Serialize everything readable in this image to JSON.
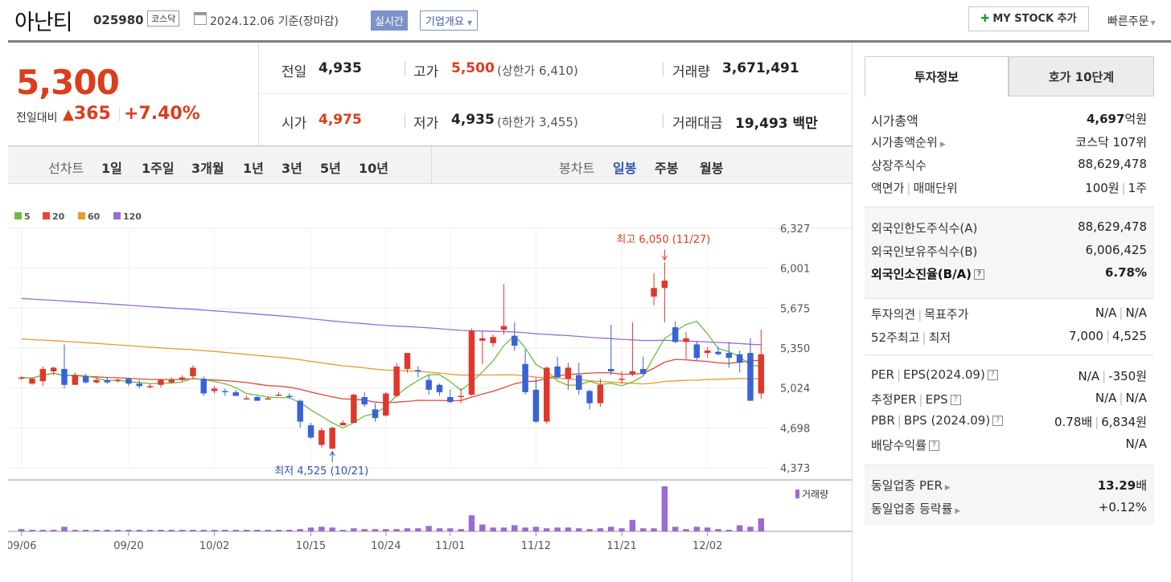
{
  "header": {
    "name": "아난티",
    "code": "025980",
    "market": "코스닥",
    "date": "2024.12.06 기준(장마감)",
    "realtime": "실시간",
    "overview": "기업개요",
    "mystock": "MY STOCK 추가",
    "quick_order": "빠른주문"
  },
  "price": {
    "current": "5,300",
    "change_label": "전일대비",
    "change": "365",
    "change_pct": "+7.40%"
  },
  "quotes": {
    "prev_label": "전일",
    "prev": "4,935",
    "high_label": "고가",
    "high": "5,500",
    "upper_limit": "(상한가 6,410)",
    "volume_label": "거래량",
    "volume": "3,671,491",
    "open_label": "시가",
    "open": "4,975",
    "low_label": "저가",
    "low": "4,935",
    "lower_limit": "(하한가 3,455)",
    "amount_label": "거래대금",
    "amount": "19,493 백만"
  },
  "periods": {
    "line_label": "선차트",
    "line_items": [
      "1일",
      "1주일",
      "3개월",
      "1년",
      "3년",
      "5년",
      "10년"
    ],
    "candle_label": "봉차트",
    "candle_items": [
      "일봉",
      "주봉",
      "월봉"
    ],
    "selected_candle": "일봉"
  },
  "tabs": {
    "invest": "투자정보",
    "hoga": "호가 10단계"
  },
  "invest": {
    "mcap_label": "시가총액",
    "mcap": "4,697",
    "mcap_unit": "억원",
    "rank_label": "시가총액순위",
    "rank": "코스닥 107위",
    "shares_label": "상장주식수",
    "shares": "88,629,478",
    "par_label": "액면가",
    "unit_label": "매매단위",
    "par": "100원",
    "unit": "1주",
    "foreign_limit_label": "외국인한도주식수(A)",
    "foreign_limit": "88,629,478",
    "foreign_hold_label": "외국인보유주식수(B)",
    "foreign_hold": "6,006,425",
    "foreign_ratio_label": "외국인소진율(B/A)",
    "foreign_ratio": "6.78%",
    "opinion_label": "투자의견",
    "target_label": "목표주가",
    "opinion": "N/A",
    "target": "N/A",
    "w52_label": "52주최고",
    "w52_low_label": "최저",
    "w52_high": "7,000",
    "w52_low": "4,525",
    "per_label": "PER",
    "eps_label": "EPS(2024.09)",
    "per": "N/A",
    "eps": "-350원",
    "eper_label": "추정PER",
    "eeps_label": "EPS",
    "eper": "N/A",
    "eeps": "N/A",
    "pbr_label": "PBR",
    "bps_label": "BPS (2024.09)",
    "pbr": "0.78배",
    "bps": "6,834원",
    "div_label": "배당수익률",
    "div": "N/A",
    "sector_per_label": "동일업종 PER",
    "sector_per": "13.29",
    "sector_per_unit": "배",
    "sector_chg_label": "동일업종 등락률",
    "sector_chg": "+0.12%"
  },
  "chart_data": {
    "type": "candlestick",
    "legend": [
      {
        "name": "5",
        "color": "#6cbf3c"
      },
      {
        "name": "20",
        "color": "#e0483c"
      },
      {
        "name": "60",
        "color": "#e89a2e"
      },
      {
        "name": "120",
        "color": "#9a6ad6"
      }
    ],
    "y_ticks": [
      "6,327",
      "6,001",
      "5,675",
      "5,350",
      "5,024",
      "4,698",
      "4,373"
    ],
    "ylim": [
      4373,
      6327
    ],
    "x_labels": [
      "09/06",
      "09/20",
      "10/02",
      "10/15",
      "10/24",
      "11/01",
      "11/12",
      "11/21",
      "12/02"
    ],
    "x_label_index": [
      0,
      10,
      18,
      27,
      34,
      40,
      48,
      56,
      64
    ],
    "high_annotation": "최고 6,050 (11/27)",
    "high_index": 60,
    "low_annotation": "최저 4,525 (10/21)",
    "low_index": 29,
    "volume_label": "거래량",
    "candles": [
      [
        5100,
        5120,
        5090,
        5110
      ],
      [
        5060,
        5110,
        5050,
        5100
      ],
      [
        5080,
        5200,
        5040,
        5180
      ],
      [
        5160,
        5200,
        5130,
        5190
      ],
      [
        5180,
        5380,
        5020,
        5050
      ],
      [
        5050,
        5150,
        5050,
        5130
      ],
      [
        5120,
        5140,
        5060,
        5070
      ],
      [
        5070,
        5110,
        5060,
        5090
      ],
      [
        5090,
        5110,
        5060,
        5070
      ],
      [
        5080,
        5100,
        5070,
        5090
      ],
      [
        5100,
        5110,
        5040,
        5060
      ],
      [
        5060,
        5090,
        5020,
        5040
      ],
      [
        5040,
        5060,
        5020,
        5040
      ],
      [
        5050,
        5100,
        5030,
        5090
      ],
      [
        5070,
        5110,
        5060,
        5090
      ],
      [
        5090,
        5130,
        5080,
        5110
      ],
      [
        5120,
        5210,
        5100,
        5190
      ],
      [
        5100,
        5120,
        4960,
        4980
      ],
      [
        5000,
        5040,
        4980,
        5020
      ],
      [
        5000,
        5020,
        4960,
        4990
      ],
      [
        4990,
        5010,
        4960,
        4960
      ],
      [
        4940,
        4960,
        4930,
        4940
      ],
      [
        4950,
        4960,
        4920,
        4920
      ],
      [
        4940,
        4960,
        4930,
        4940
      ],
      [
        4970,
        4990,
        4960,
        4970
      ],
      [
        4960,
        4980,
        4940,
        4950
      ],
      [
        4920,
        4930,
        4700,
        4750
      ],
      [
        4720,
        4740,
        4610,
        4620
      ],
      [
        4560,
        4700,
        4540,
        4680
      ],
      [
        4530,
        4710,
        4525,
        4700
      ],
      [
        4720,
        4760,
        4720,
        4740
      ],
      [
        4740,
        4980,
        4740,
        4970
      ],
      [
        4950,
        4990,
        4870,
        4890
      ],
      [
        4850,
        4900,
        4750,
        4780
      ],
      [
        4800,
        4990,
        4790,
        4980
      ],
      [
        4960,
        5230,
        4950,
        5200
      ],
      [
        5180,
        5310,
        5150,
        5310
      ],
      [
        5170,
        5200,
        5110,
        5160
      ],
      [
        5090,
        5130,
        4970,
        5010
      ],
      [
        5050,
        5060,
        4960,
        4990
      ],
      [
        4950,
        5010,
        4900,
        4910
      ],
      [
        4950,
        5020,
        4900,
        4960
      ],
      [
        4970,
        5510,
        4960,
        5490
      ],
      [
        5410,
        5490,
        5220,
        5430
      ],
      [
        5390,
        5460,
        5360,
        5440
      ],
      [
        5500,
        5870,
        5460,
        5530
      ],
      [
        5450,
        5560,
        5330,
        5370
      ],
      [
        5220,
        5340,
        4970,
        4990
      ],
      [
        5010,
        5110,
        4740,
        4750
      ],
      [
        4750,
        5200,
        4730,
        5190
      ],
      [
        5200,
        5280,
        5110,
        5110
      ],
      [
        5100,
        5230,
        5010,
        5190
      ],
      [
        5130,
        5230,
        4970,
        5010
      ],
      [
        5000,
        5010,
        4850,
        4900
      ],
      [
        4900,
        5100,
        4870,
        5050
      ],
      [
        5180,
        5540,
        5130,
        5160
      ],
      [
        5100,
        5160,
        5060,
        5100
      ],
      [
        5140,
        5560,
        5120,
        5160
      ],
      [
        5180,
        5280,
        5130,
        5140
      ],
      [
        5770,
        5960,
        5700,
        5840
      ],
      [
        5840,
        6050,
        5560,
        5900
      ],
      [
        5520,
        5570,
        5390,
        5400
      ],
      [
        5400,
        5480,
        5260,
        5430
      ],
      [
        5380,
        5400,
        5250,
        5270
      ],
      [
        5310,
        5360,
        5270,
        5330
      ],
      [
        5320,
        5360,
        5290,
        5300
      ],
      [
        5310,
        5400,
        5190,
        5270
      ],
      [
        5300,
        5330,
        5150,
        5230
      ],
      [
        5310,
        5430,
        5140,
        4920
      ],
      [
        4980,
        5500,
        4935,
        5300
      ]
    ],
    "volumes": [
      3,
      2,
      2,
      2,
      6,
      2,
      2,
      2,
      2,
      2,
      2,
      2,
      2,
      2,
      2,
      2,
      2,
      2,
      2,
      2,
      2,
      2,
      2,
      2,
      2,
      2,
      3,
      5,
      6,
      5,
      2,
      4,
      3,
      3,
      3,
      3,
      4,
      4,
      7,
      4,
      4,
      3,
      21,
      9,
      5,
      5,
      8,
      5,
      6,
      4,
      5,
      5,
      4,
      3,
      4,
      6,
      4,
      15,
      4,
      4,
      59,
      6,
      3,
      6,
      5,
      3,
      2,
      8,
      6,
      17
    ]
  }
}
